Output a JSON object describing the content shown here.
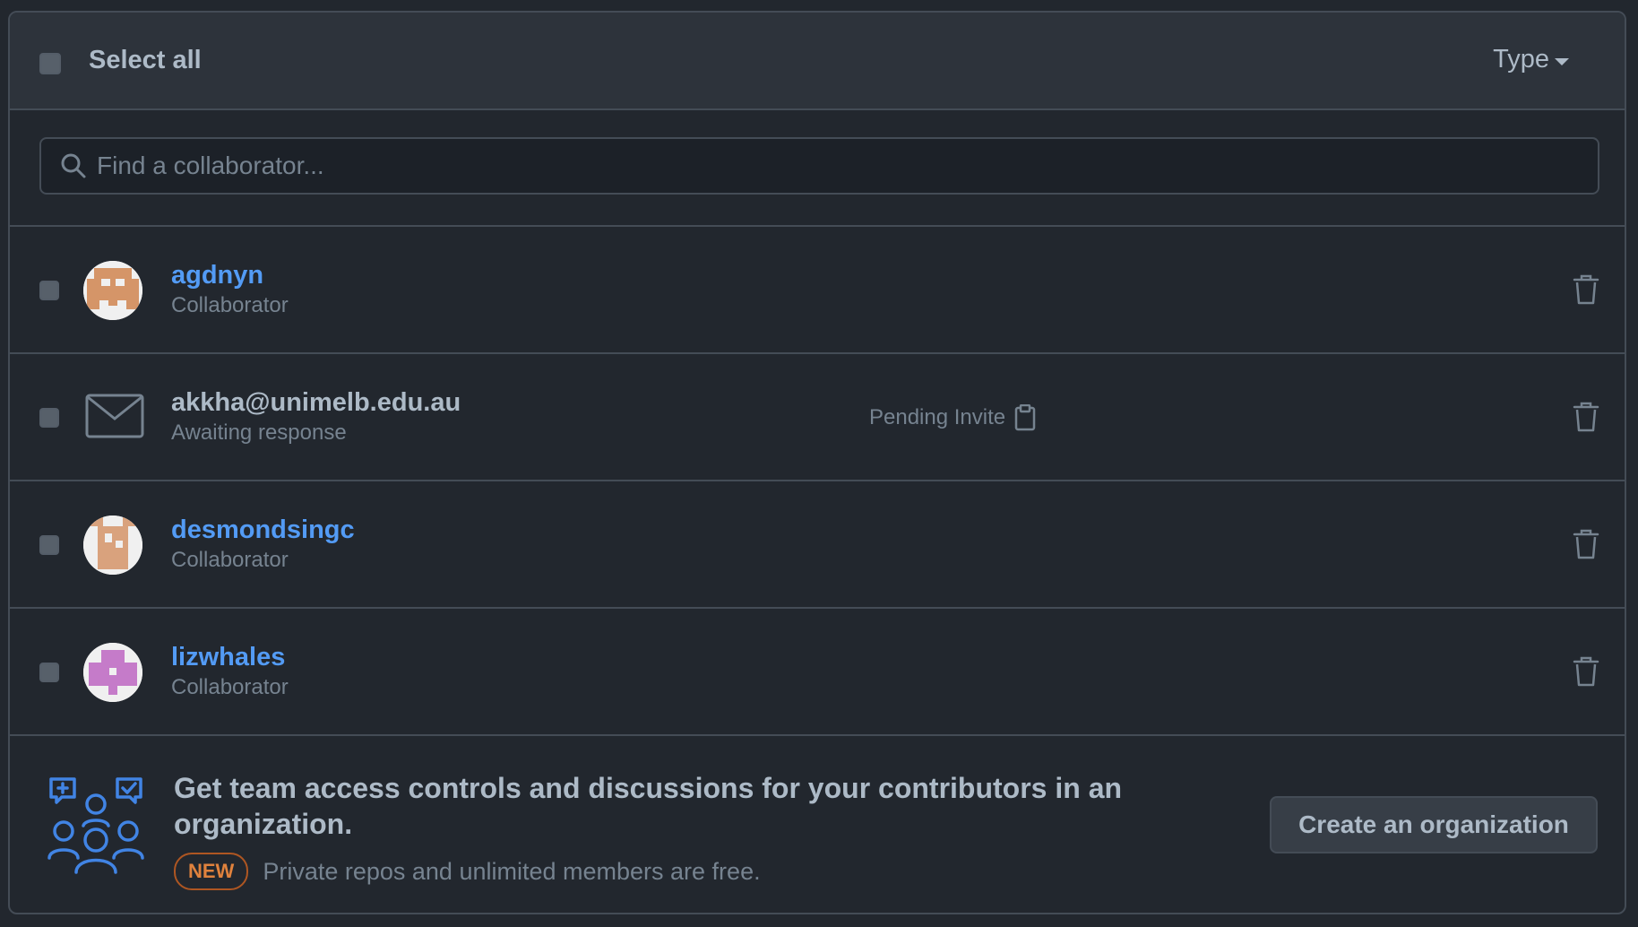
{
  "header": {
    "select_all_label": "Select all",
    "type_filter_label": "Type"
  },
  "search": {
    "placeholder": "Find a collaborator..."
  },
  "collaborators": [
    {
      "name": "agdnyn",
      "role": "Collaborator",
      "avatar_color": "#d59568"
    },
    {
      "name": "akkha@unimelb.edu.au",
      "role": "Awaiting response",
      "status": "Pending Invite",
      "icon": "mail-icon"
    },
    {
      "name": "desmondsingc",
      "role": "Collaborator",
      "avatar_color": "#d9a27d"
    },
    {
      "name": "lizwhales",
      "role": "Collaborator",
      "avatar_color": "#c57bc9"
    }
  ],
  "promo": {
    "title": "Get team access controls and discussions for your contributors in an organization.",
    "badge": "NEW",
    "subtitle": "Private repos and unlimited members are free.",
    "button_label": "Create an organization"
  },
  "colors": {
    "link": "#539bf5",
    "accent_orange": "#e0823d",
    "icon_blue": "#4184e4"
  }
}
